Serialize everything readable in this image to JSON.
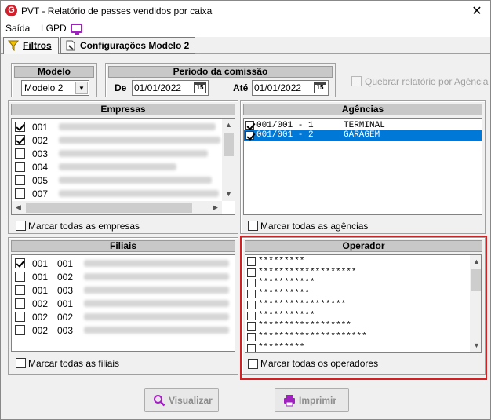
{
  "window": {
    "title": "PVT - Relatório de passes vendidos por caixa",
    "close_glyph": "✕"
  },
  "menu": {
    "items": [
      "Saída",
      "LGPD"
    ],
    "lgpd_icon": "monitor-icon"
  },
  "tabs": [
    {
      "label": "Filtros",
      "icon": "funnel-icon",
      "active": true
    },
    {
      "label": "Configurações Modelo 2",
      "icon": "document-settings-icon",
      "active": false
    }
  ],
  "modelo": {
    "header": "Modelo",
    "value": "Modelo 2"
  },
  "periodo": {
    "header": "Período da comissão",
    "de_label": "De",
    "de_value": "01/01/2022",
    "ate_label": "Até",
    "ate_value": "01/01/2022",
    "calendar_glyph": "15"
  },
  "quebrar": {
    "label": "Quebrar relatório por Agência",
    "checked": false,
    "enabled": false
  },
  "empresas": {
    "header": "Empresas",
    "rows": [
      {
        "checked": true,
        "code": "001"
      },
      {
        "checked": true,
        "code": "002"
      },
      {
        "checked": false,
        "code": "003"
      },
      {
        "checked": false,
        "code": "004"
      },
      {
        "checked": false,
        "code": "005"
      },
      {
        "checked": false,
        "code": "007"
      }
    ],
    "marcar_label": "Marcar todas as empresas"
  },
  "agencias": {
    "header": "Agências",
    "rows": [
      {
        "checked": true,
        "code": "001/001 - 1",
        "name": "TERMINAL",
        "selected": false
      },
      {
        "checked": true,
        "code": "001/001 - 2",
        "name": "GARAGEM",
        "selected": true
      }
    ],
    "marcar_label": "Marcar todas as agências"
  },
  "filiais": {
    "header": "Filiais",
    "rows": [
      {
        "checked": true,
        "empresa": "001",
        "filial": "001"
      },
      {
        "checked": false,
        "empresa": "001",
        "filial": "002"
      },
      {
        "checked": false,
        "empresa": "001",
        "filial": "003"
      },
      {
        "checked": false,
        "empresa": "002",
        "filial": "001"
      },
      {
        "checked": false,
        "empresa": "002",
        "filial": "002"
      },
      {
        "checked": false,
        "empresa": "002",
        "filial": "003"
      }
    ],
    "marcar_label": "Marcar todas as filiais"
  },
  "operador": {
    "header": "Operador",
    "rows": [
      "*********",
      "*******************",
      "***********",
      "**********",
      "*****************",
      "***********",
      "******************",
      "*********************",
      "*********"
    ],
    "marcar_label": "Marcar todas os operadores"
  },
  "buttons": {
    "visualizar": {
      "label": "Visualizar",
      "icon": "magnifier-icon",
      "enabled": false
    },
    "imprimir": {
      "label": "Imprimir",
      "icon": "printer-icon",
      "enabled": false
    }
  },
  "colors": {
    "highlight": "#d42020",
    "selection": "#0078d7",
    "header_bg": "#c8c8c8",
    "button_icon": "#a020c0"
  }
}
